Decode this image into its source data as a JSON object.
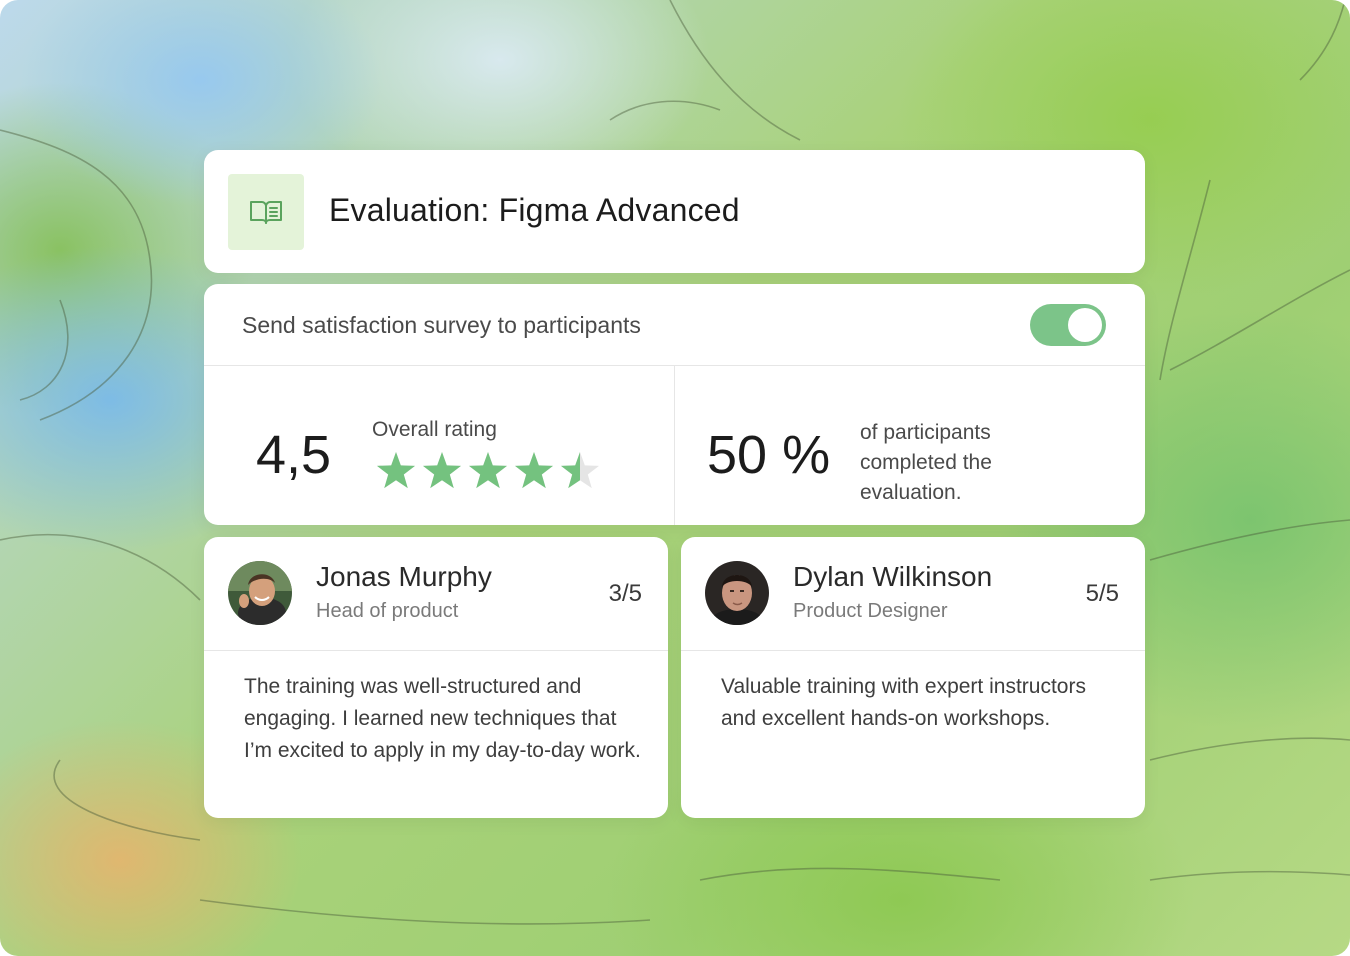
{
  "header": {
    "icon": "open-book-icon",
    "title": "Evaluation: Figma Advanced"
  },
  "survey": {
    "label": "Send satisfaction survey to participants",
    "toggle_on": true
  },
  "rating": {
    "value": "4,5",
    "label": "Overall rating",
    "stars": 4.5,
    "max_stars": 5
  },
  "completion": {
    "value": "50 %",
    "text": "of participants completed the evaluation."
  },
  "reviews": [
    {
      "name": "Jonas Murphy",
      "role": "Head of product",
      "score": "3/5",
      "text": "The training was well-structured and engaging. I learned new techniques that I’m excited to apply in my day-to-day work."
    },
    {
      "name": "Dylan Wilkinson",
      "role": "Product Designer",
      "score": "5/5",
      "text": "Valuable training with expert instructors and excellent hands-on workshops."
    }
  ],
  "colors": {
    "accent_green": "#7cc489",
    "star_green": "#74c27f",
    "icon_bg": "#e4f3d9",
    "star_empty": "#e5e5e5"
  }
}
